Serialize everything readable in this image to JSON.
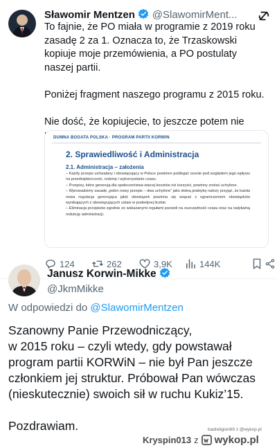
{
  "tweet1": {
    "author_name": "Sławomir Mentzen",
    "author_handle": "@SlawomirMent...",
    "text": "To fajnie, że PO miała w programie z 2019 roku zasadę 2 za 1. Oznacza to, że Trzaskowski kopiuje moje przemówienia, a PO postulaty naszej partii.\n\nPoniżej fragment naszego programu z 2015 roku.\n\nNie dość, że kopiujecie, to jeszcze potem nie realizujecie, gdy już rządzicie!",
    "embedded_doc": {
      "header": "DUMNA BOGATA POLSKA · PROGRAM PARTII KORWIN",
      "title": "2. Sprawiedliwość i Administracja",
      "subtitle": "2.1. Administracja – założenia",
      "body": "– Każdy przepis uchwalany i obowiązujący w Polsce powinien podlegać ocenie pod względem jego wpływu na przedsiębiorczość, rodzinę i wykorzystanie czasu.\n– Przepisy, które generują dla społeczeństwa więcej kosztów niż korzyści, powinny zostać uchylone.\n– Wprowadzimy zasadę „jeden nowy przepis – dwa uchylone” jako dobrą praktykę należy przyjąć, że każda nowa regulacja generująca jakiś obowiązek powinna się wiązać z ograniczeniem obowiązków wynikających z obowiązujących ustaw w podwójnej liczbie.\n– Eliminacja przepisów zgodnie ze wskazanymi regułami pozwoli na oszczędność czasu oraz na radykalną redukcję administracji."
    },
    "metrics": {
      "replies": "124",
      "reposts": "262",
      "likes": "3,9K",
      "views": "144K"
    }
  },
  "tweet2": {
    "author_name": "Janusz Korwin-Mikke",
    "author_handle": "@JkmMikke",
    "reply_prefix": "W odpowiedzi do",
    "reply_mention": "@SlawomirMentzen",
    "text": "Szanowny Panie Przewodniczący,\nw 2015 roku – czyli wtedy, gdy powstawał program partii KORWiN – nie był Pan jeszcze członkiem jej struktur. Próbował Pan wówczas (nieskutecznie) swoich sił w ruchu Kukiz’15.\n\nPozdrawiam."
  },
  "watermark": {
    "small": "badreligion69  z  @wykop.pl",
    "user": "Kryspin013",
    "z": "z",
    "brand": "wykop.pl"
  },
  "colors": {
    "accent_blue": "#1d9bf0",
    "gold_verified": "#e2b719",
    "doc_title_blue": "#1b4f8c",
    "gray_text": "#536471"
  }
}
